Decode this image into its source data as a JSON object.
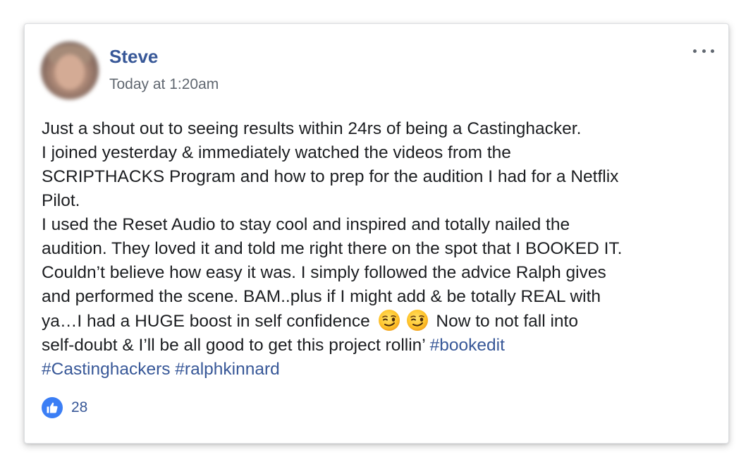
{
  "post": {
    "author": "Steve",
    "timestamp": "Today at 1:20am",
    "options_icon": "more-options-icon",
    "body_lines": {
      "l1": "Just a shout out to seeing results within 24rs of being a Castinghacker.",
      "l2": "I joined yesterday & immediately watched the videos from the",
      "l3": "SCRIPTHACKS Program and how to prep for the audition I had for a Netflix",
      "l4": "Pilot.",
      "l5": "I used the Reset Audio to stay cool and inspired and totally nailed the",
      "l6": "audition. They loved it and told me right there on the spot that I BOOKED IT.",
      "l7": "Couldn’t believe how easy it was. I simply followed the advice Ralph gives",
      "l8": "and performed the scene. BAM..plus if I might add & be totally REAL with",
      "l9a": "ya…I had a HUGE boost in self confidence",
      "l9b": "Now to not fall into",
      "l10": "self-doubt & I’ll be all good to get this project rollin’"
    },
    "hashtags": {
      "h1": "#bookedit",
      "h2": "#Castinghackers",
      "h3": "#ralphkinnard"
    },
    "emoji": "winking-face",
    "reactions": {
      "icon": "like-thumbs-up-icon",
      "count": "28",
      "color": "#3b7ef5"
    }
  },
  "colors": {
    "link": "#385898",
    "text": "#1c1e21",
    "meta": "#606770"
  }
}
